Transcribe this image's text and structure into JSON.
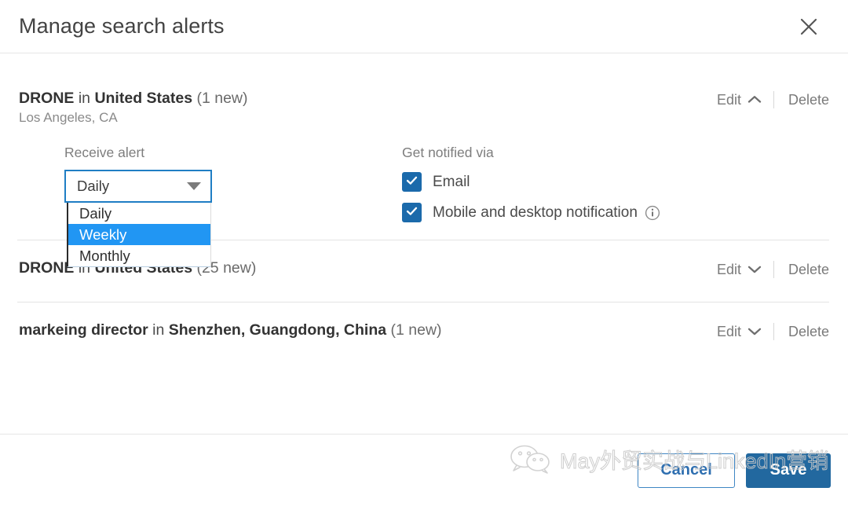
{
  "header": {
    "title": "Manage search alerts",
    "close_icon": "close-icon"
  },
  "alerts": [
    {
      "keyword": "DRONE",
      "connector": " in ",
      "location": "United States",
      "count": " (1 new)",
      "sublocation": "Los Angeles, CA",
      "edit_label": "Edit",
      "delete_label": "Delete",
      "expanded": true,
      "settings": {
        "receive_label": "Receive alert",
        "frequency_value": "Daily",
        "frequency_options": [
          "Daily",
          "Weekly",
          "Monthly"
        ],
        "frequency_highlighted": "Weekly",
        "notify_label": "Get notified via",
        "channels": [
          {
            "label": "Email",
            "checked": true,
            "has_info": false
          },
          {
            "label": "Mobile and desktop notification",
            "checked": true,
            "has_info": true
          }
        ]
      }
    },
    {
      "keyword": "DRONE",
      "connector": " in ",
      "location": "United States",
      "count": " (25 new)",
      "sublocation": "",
      "edit_label": "Edit",
      "delete_label": "Delete",
      "expanded": false
    },
    {
      "keyword": "markeing director",
      "connector": " in ",
      "location": "Shenzhen, Guangdong, China",
      "count": " (1 new)",
      "sublocation": "",
      "edit_label": "Edit",
      "delete_label": "Delete",
      "expanded": false
    }
  ],
  "footer": {
    "cancel_label": "Cancel",
    "save_label": "Save"
  },
  "watermark": {
    "text": "May外贸实战与LinkedIn营销",
    "logo_icon": "wechat-logo-icon"
  },
  "colors": {
    "accent_blue": "#0a66c2",
    "select_border": "#1f7ec4",
    "option_highlight": "#2196f3",
    "checkbox_fill": "#1b6aab",
    "save_button": "#22689f",
    "cancel_border": "#3f86c4",
    "divider": "#e3e3e3",
    "title_text": "#434343",
    "muted_text": "#7a7a7a"
  }
}
